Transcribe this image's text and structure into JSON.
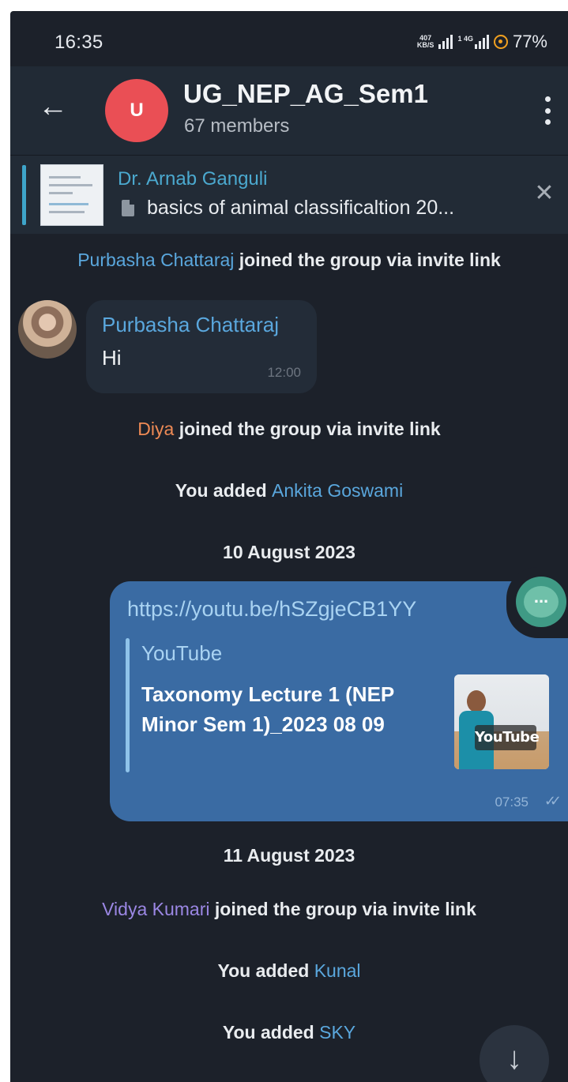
{
  "status_bar": {
    "time": "16:35",
    "net_speed_top": "407",
    "net_speed_bottom": "KB/S",
    "sim2_label": "1 4G",
    "battery": "77%"
  },
  "header": {
    "avatar_letter": "U",
    "title": "UG_NEP_AG_Sem1",
    "members": "67 members"
  },
  "pinned": {
    "author": "Dr. Arnab Ganguli",
    "text": "basics of animal classificaltion 20..."
  },
  "messages": {
    "m1": {
      "name": "Purbasha Chattaraj",
      "text": " joined the group via invite link"
    },
    "m2": {
      "sender": "Purbasha Chattaraj",
      "text": "Hi",
      "time": "12:00"
    },
    "m3": {
      "name": "Diya",
      "text": " joined the group via invite link"
    },
    "m4": {
      "prefix": "You added ",
      "name": "Ankita Goswami"
    },
    "date1": "10 August 2023",
    "m5": {
      "link": "https://youtu.be/hSZgjeCB1YY",
      "site": "YouTube",
      "title": "Taxonomy Lecture 1 (NEP Minor Sem 1)_2023 08 09",
      "thumb_logo": "YouTube",
      "time": "07:35",
      "check": "✓✓"
    },
    "date2": "11 August 2023",
    "m6": {
      "name": "Vidya Kumari",
      "text": " joined the group via invite link"
    },
    "m7": {
      "prefix": "You added ",
      "name": "Kunal"
    },
    "m8": {
      "prefix": "You added ",
      "name": "SKY"
    }
  },
  "icons": {
    "back": "←",
    "close": "✕",
    "scroll_down": "↓"
  },
  "colors": {
    "chat_bg": "#1c212a",
    "header_bg": "#212a35",
    "outgoing_bubble": "#3a6ba3",
    "avatar_red": "#ea4f55",
    "link_name_blue": "#5aa7dd",
    "name_orange": "#ee8a55",
    "name_purple": "#9b87e4"
  }
}
